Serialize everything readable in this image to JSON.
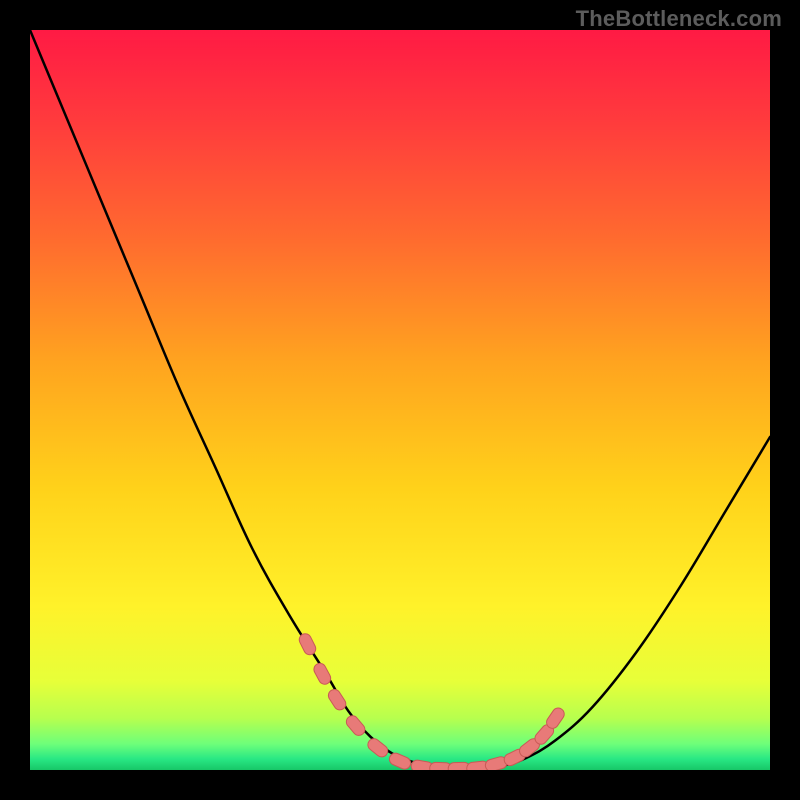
{
  "watermark": {
    "text": "TheBottleneck.com"
  },
  "colors": {
    "frame": "#000000",
    "curve": "#000000",
    "marker_fill": "#e87a78",
    "marker_stroke": "#c95a56",
    "gradient_stops": [
      {
        "offset": 0.0,
        "color": "#ff1a44"
      },
      {
        "offset": 0.12,
        "color": "#ff3a3d"
      },
      {
        "offset": 0.28,
        "color": "#ff6a2f"
      },
      {
        "offset": 0.45,
        "color": "#ffa41f"
      },
      {
        "offset": 0.62,
        "color": "#ffd21a"
      },
      {
        "offset": 0.78,
        "color": "#fff22a"
      },
      {
        "offset": 0.88,
        "color": "#e7ff39"
      },
      {
        "offset": 0.93,
        "color": "#b7ff4e"
      },
      {
        "offset": 0.965,
        "color": "#6dff7a"
      },
      {
        "offset": 0.985,
        "color": "#29e884"
      },
      {
        "offset": 1.0,
        "color": "#17c667"
      }
    ]
  },
  "chart_data": {
    "type": "line",
    "title": "",
    "xlabel": "",
    "ylabel": "",
    "xlim": [
      0,
      1
    ],
    "ylim": [
      0,
      1
    ],
    "grid": false,
    "legend": false,
    "series": [
      {
        "name": "bottleneck-curve",
        "x": [
          0.0,
          0.05,
          0.1,
          0.15,
          0.2,
          0.25,
          0.3,
          0.35,
          0.4,
          0.43,
          0.46,
          0.49,
          0.52,
          0.55,
          0.58,
          0.61,
          0.64,
          0.67,
          0.71,
          0.76,
          0.82,
          0.88,
          0.94,
          1.0
        ],
        "y": [
          1.0,
          0.88,
          0.76,
          0.64,
          0.52,
          0.41,
          0.3,
          0.21,
          0.13,
          0.08,
          0.045,
          0.022,
          0.01,
          0.003,
          0.001,
          0.002,
          0.006,
          0.016,
          0.04,
          0.085,
          0.16,
          0.25,
          0.35,
          0.45
        ]
      }
    ],
    "markers": {
      "name": "highlight-points",
      "x": [
        0.375,
        0.395,
        0.415,
        0.44,
        0.47,
        0.5,
        0.53,
        0.555,
        0.58,
        0.605,
        0.63,
        0.655,
        0.675,
        0.695,
        0.71
      ],
      "y": [
        0.17,
        0.13,
        0.095,
        0.06,
        0.03,
        0.012,
        0.004,
        0.002,
        0.002,
        0.003,
        0.008,
        0.017,
        0.03,
        0.048,
        0.07
      ]
    }
  }
}
